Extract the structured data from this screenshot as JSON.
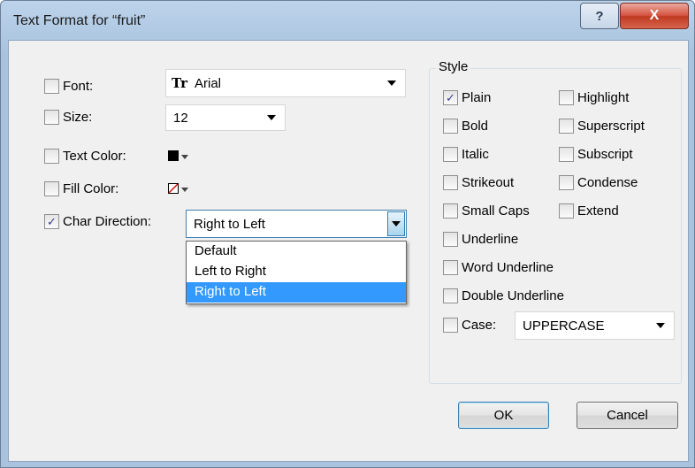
{
  "window": {
    "title": "Text Format for “fruit”",
    "help_glyph": "?",
    "close_glyph": "X"
  },
  "left": {
    "font": {
      "label": "Font:",
      "checked": false,
      "value": "Arial",
      "icon": "truetype-font-icon",
      "glyph": "Tr"
    },
    "size": {
      "label": "Size:",
      "checked": false,
      "value": "12"
    },
    "text_color": {
      "label": "Text Color:",
      "checked": false,
      "color": "#000000"
    },
    "fill_color": {
      "label": "Fill Color:",
      "checked": false,
      "color": "none"
    },
    "char_direction": {
      "label": "Char Direction:",
      "checked": true,
      "value": "Right to Left",
      "options": [
        "Default",
        "Left to Right",
        "Right to Left"
      ],
      "selected_index": 2
    }
  },
  "style": {
    "title": "Style",
    "col1": [
      {
        "label": "Plain",
        "checked": true
      },
      {
        "label": "Bold",
        "checked": false
      },
      {
        "label": "Italic",
        "checked": false
      },
      {
        "label": "Strikeout",
        "checked": false
      },
      {
        "label": "Small Caps",
        "checked": false
      },
      {
        "label": "Underline",
        "checked": false
      },
      {
        "label": "Word Underline",
        "checked": false
      },
      {
        "label": "Double Underline",
        "checked": false
      }
    ],
    "col2": [
      {
        "label": "Highlight",
        "checked": false
      },
      {
        "label": "Superscript",
        "checked": false
      },
      {
        "label": "Subscript",
        "checked": false
      },
      {
        "label": "Condense",
        "checked": false
      },
      {
        "label": "Extend",
        "checked": false
      }
    ],
    "case": {
      "label": "Case:",
      "checked": false,
      "value": "UPPERCASE"
    }
  },
  "buttons": {
    "ok": "OK",
    "cancel": "Cancel"
  },
  "colors": {
    "selection": "#3399ff",
    "client_bg": "#f0f0f0",
    "close_red": "#c03a22"
  },
  "check_glyph": "✓"
}
